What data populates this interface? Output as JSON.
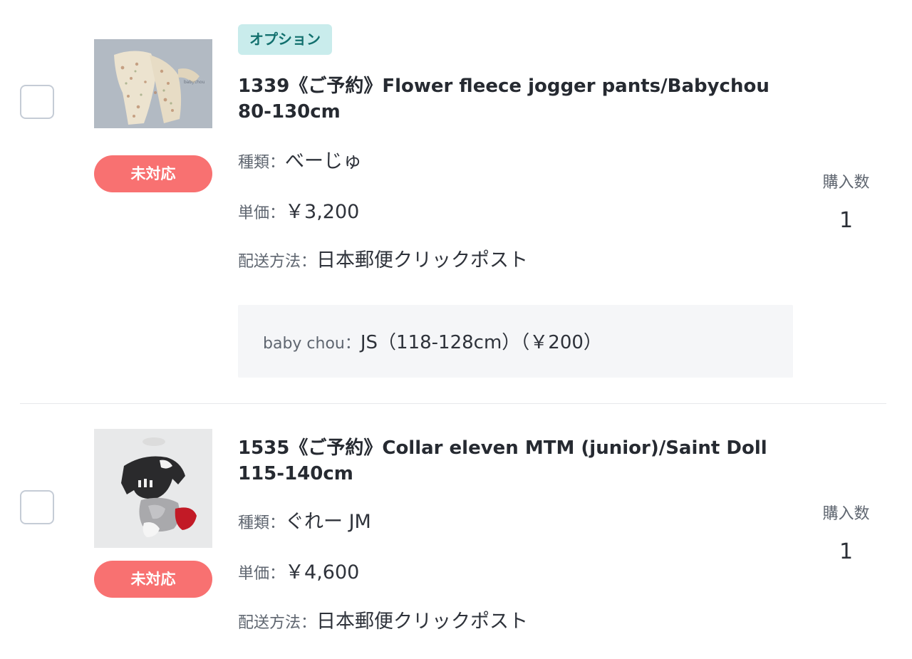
{
  "items": [
    {
      "option_tag": "オプション",
      "status": "未対応",
      "title": "1339《ご予約》Flower fleece jogger pants/Babychou 80-130cm",
      "type_label": "種類：",
      "type_value": "べーじゅ",
      "price_label": "単価：",
      "price_value": "￥3,200",
      "shipping_label": "配送方法：",
      "shipping_value": "日本郵便クリックポスト",
      "option": {
        "label": "baby chou：",
        "value": "JS（118-128cm）（￥200）"
      },
      "qty_label": "購入数",
      "qty_value": "1"
    },
    {
      "status": "未対応",
      "title": "1535《ご予約》Collar eleven MTM (junior)/Saint Doll 115-140cm",
      "type_label": "種類：",
      "type_value": "ぐれー JM",
      "price_label": "単価：",
      "price_value": "￥4,600",
      "shipping_label": "配送方法：",
      "shipping_value": "日本郵便クリックポスト",
      "qty_label": "購入数",
      "qty_value": "1"
    }
  ],
  "colors": {
    "status_badge": "#f87171",
    "option_tag_bg": "#c9ecec",
    "option_tag_text": "#12706e"
  }
}
